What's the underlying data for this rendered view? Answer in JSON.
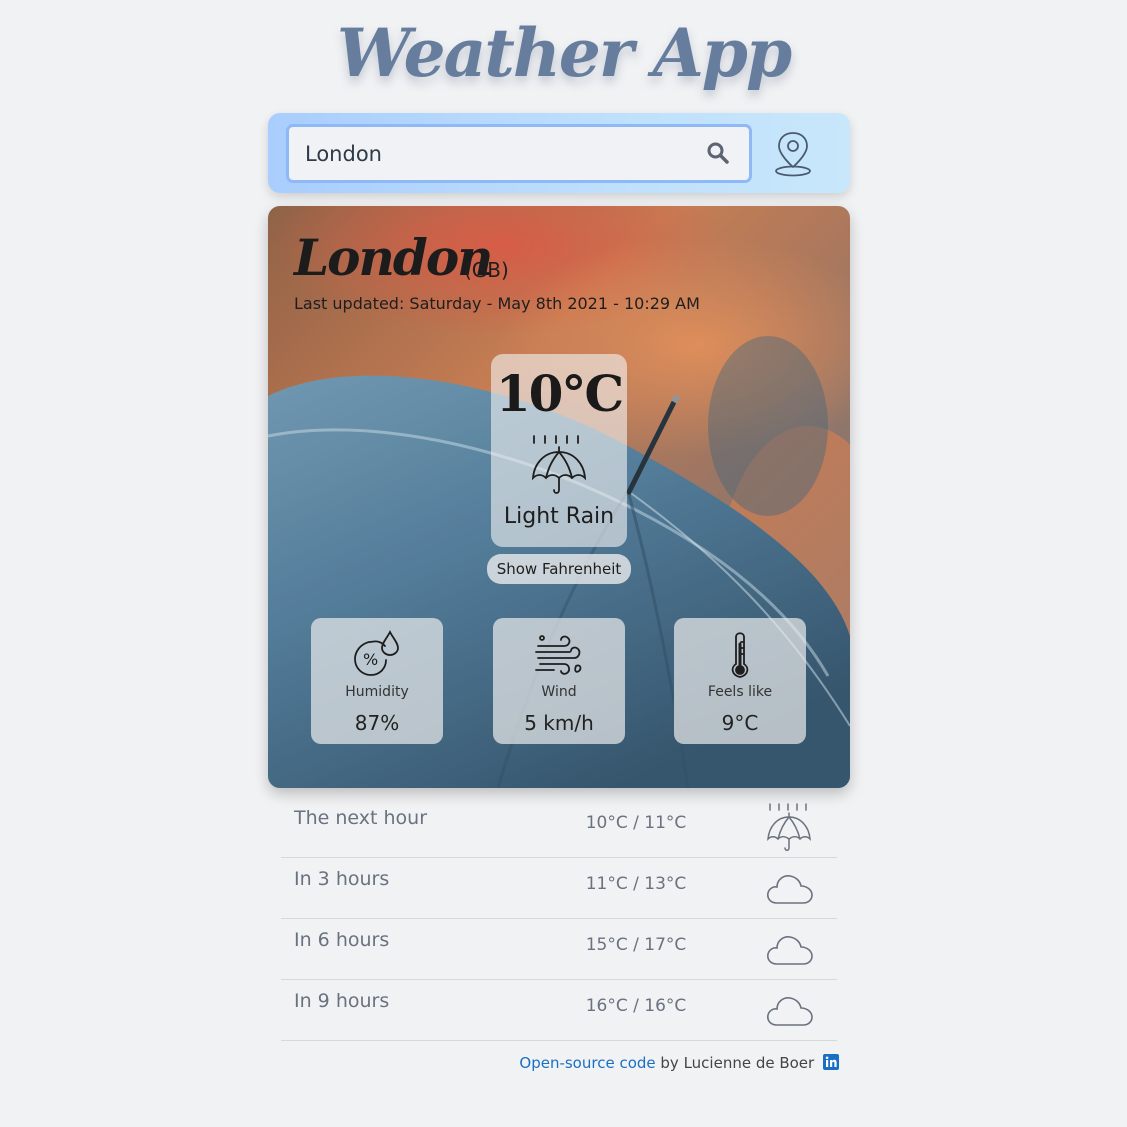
{
  "app": {
    "title": "Weather App"
  },
  "search": {
    "value": "London",
    "search_icon": "search-icon",
    "location_icon": "map-pin-icon"
  },
  "current": {
    "city": "London",
    "country": "(GB)",
    "last_updated": "Last updated: Saturday - May 8th 2021 - 10:29 AM",
    "temperature": "10°C",
    "condition": "Light Rain",
    "condition_icon": "umbrella-rain-icon",
    "unit_toggle_label": "Show Fahrenheit"
  },
  "stats": [
    {
      "label": "Humidity",
      "value": "87%",
      "icon": "humidity-icon"
    },
    {
      "label": "Wind",
      "value": "5 km/h",
      "icon": "wind-icon"
    },
    {
      "label": "Feels like",
      "value": "9°C",
      "icon": "thermometer-icon"
    }
  ],
  "forecast": [
    {
      "label": "The next hour",
      "temps": "10°C / 11°C",
      "icon": "umbrella-rain-icon"
    },
    {
      "label": "In 3 hours",
      "temps": "11°C / 13°C",
      "icon": "cloud-icon"
    },
    {
      "label": "In 6 hours",
      "temps": "15°C / 17°C",
      "icon": "cloud-icon"
    },
    {
      "label": "In 9 hours",
      "temps": "16°C / 16°C",
      "icon": "cloud-icon"
    }
  ],
  "footer": {
    "link_text": "Open-source code",
    "by_text": "by Lucienne de Boer",
    "social_icon": "linkedin-icon"
  }
}
